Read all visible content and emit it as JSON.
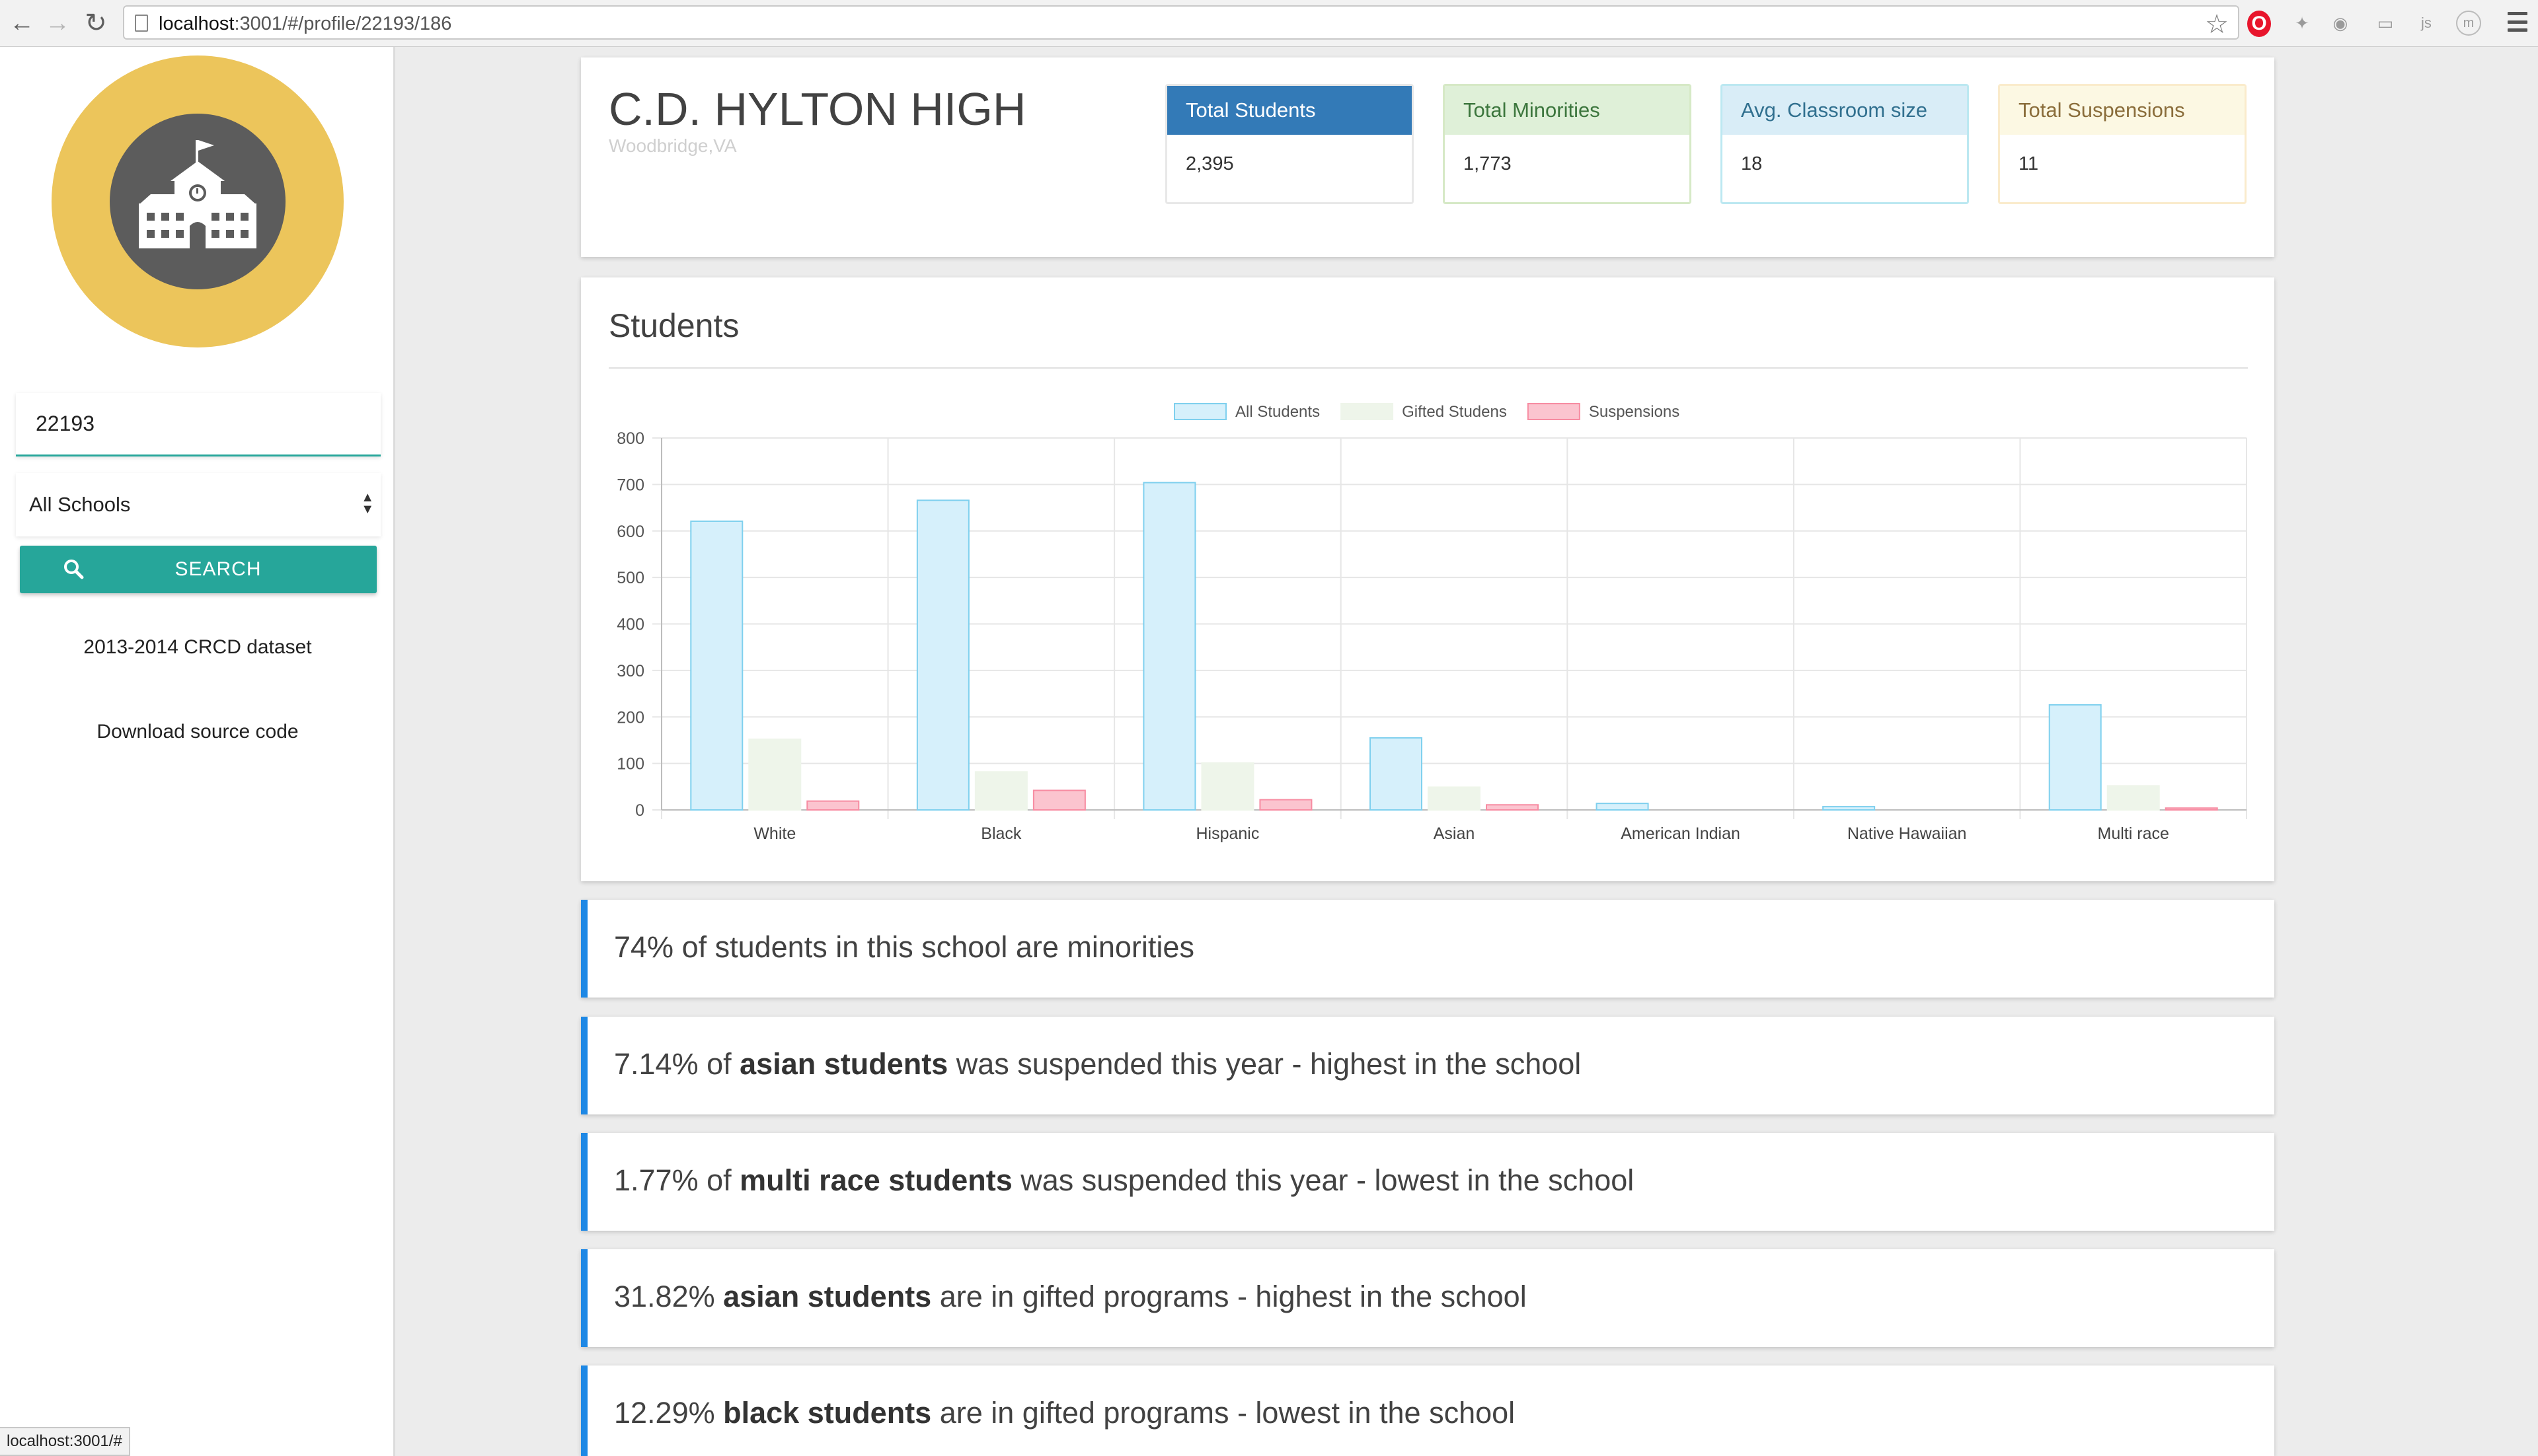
{
  "browser": {
    "url_host": "localhost",
    "url_path": ":3001/#/profile/22193/186",
    "status_url": "localhost:3001/#"
  },
  "sidebar": {
    "zip_value": "22193",
    "school_filter": "All Schools",
    "search_label": "SEARCH",
    "dataset_link": "2013-2014 CRCD dataset",
    "source_link": "Download source code"
  },
  "school": {
    "name": "C.D. HYLTON HIGH",
    "location": "Woodbridge,VA"
  },
  "stats": [
    {
      "label": "Total Students",
      "value": "2,395",
      "head_bg": "#337ab7",
      "head_fg": "#ffffff",
      "border": "#e8e8e8"
    },
    {
      "label": "Total Minorities",
      "value": "1,773",
      "head_bg": "#dff0d8",
      "head_fg": "#3c763d",
      "border": "#d6e9c6"
    },
    {
      "label": "Avg. Classroom size",
      "value": "18",
      "head_bg": "#d9edf7",
      "head_fg": "#31708f",
      "border": "#bce8f1"
    },
    {
      "label": "Total Suspensions",
      "value": "11",
      "head_bg": "#fcf8e3",
      "head_fg": "#8a6d3b",
      "border": "#faebcc"
    }
  ],
  "students_section": {
    "title": "Students"
  },
  "chart_data": {
    "type": "bar",
    "categories": [
      "White",
      "Black",
      "Hispanic",
      "Asian",
      "American Indian",
      "Native Hawaiian",
      "Multi race"
    ],
    "series": [
      {
        "name": "All Students",
        "values": [
          621,
          666,
          704,
          155,
          14,
          7,
          226
        ],
        "fill": "#d6f0fb",
        "stroke": "#7fd0ee"
      },
      {
        "name": "Gifted Studens",
        "values": [
          152,
          82,
          101,
          49,
          0,
          0,
          52
        ],
        "fill": "#eef5ea",
        "stroke": "#eef5ea"
      },
      {
        "name": "Suspensions",
        "values": [
          19,
          42,
          22,
          11,
          0,
          0,
          4
        ],
        "fill": "#fbc4cf",
        "stroke": "#f78ca2"
      }
    ],
    "ylim": [
      0,
      800
    ],
    "yticks": [
      0,
      100,
      200,
      300,
      400,
      500,
      600,
      700,
      800
    ],
    "grid": true,
    "legend": "top-center"
  },
  "insights": [
    {
      "pre": "74% of students in this school are minorities",
      "bold": "",
      "post": ""
    },
    {
      "pre": "7.14% of ",
      "bold": "asian students",
      "post": " was suspended this year - highest in the school"
    },
    {
      "pre": "1.77% of ",
      "bold": "multi race students",
      "post": " was suspended this year - lowest in the school"
    },
    {
      "pre": "31.82% ",
      "bold": "asian students",
      "post": " are in gifted programs - highest in the school"
    },
    {
      "pre": "12.29% ",
      "bold": "black students",
      "post": " are in gifted programs - lowest in the school"
    }
  ]
}
